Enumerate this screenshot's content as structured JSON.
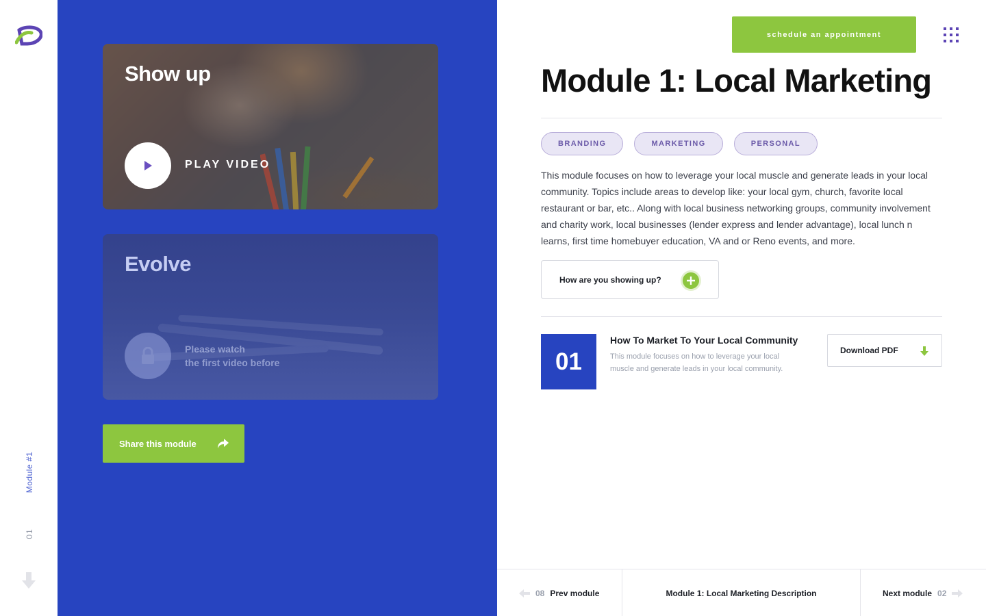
{
  "brand": {
    "logo_icon": "brand-logo-icon",
    "accent_green": "#8dc63f",
    "accent_blue": "#2744c0",
    "accent_purple": "#5c44b4"
  },
  "rail": {
    "module_label": "Module #1",
    "module_number": "01",
    "scroll_icon": "arrow-down-icon"
  },
  "cards": [
    {
      "title": "Show up",
      "action_label": "PLAY VIDEO",
      "action_icon": "play-icon",
      "locked": false
    },
    {
      "title": "Evolve",
      "action_label_line1": "Please watch",
      "action_label_line2": "the first video before",
      "action_icon": "lock-icon",
      "locked": true
    }
  ],
  "share": {
    "label": "Share this module",
    "icon": "share-icon"
  },
  "header": {
    "schedule_label": "schedule an appointment",
    "menu_icon": "grid-menu-icon"
  },
  "module": {
    "title": "Module 1: Local Marketing",
    "tags": [
      "BRANDING",
      "MARKETING",
      "PERSONAL"
    ],
    "description": "This module focuses on how to leverage your local muscle and generate leads in your local community. Topics include areas to develop like: your local gym, church, favorite local restaurant or bar, etc.. Along with local business networking groups, community involvement and charity work, local businesses (lender express and lender advantage), local lunch n learns, first time homebuyer education, VA and or Reno events, and more.",
    "question_label": "How are you showing up?",
    "question_icon": "plus-circle-icon"
  },
  "lesson": {
    "number": "01",
    "title": "How To Market To Your Local Community",
    "description": "This module focuses on how to leverage your local muscle and generate leads in your local community.",
    "download_label": "Download PDF",
    "download_icon": "download-arrow-icon"
  },
  "footer": {
    "prev_number": "08",
    "prev_label": "Prev module",
    "center_label": "Module 1: Local Marketing Description",
    "next_label": "Next module",
    "next_number": "02"
  }
}
